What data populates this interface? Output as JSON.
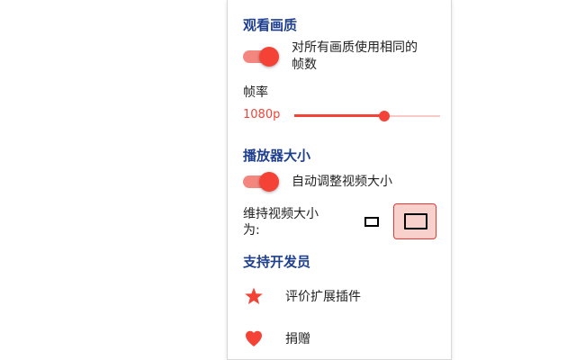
{
  "colors": {
    "accent": "#f44336",
    "section_title": "#1f3f8f",
    "toggle_track": "#f3877f",
    "size_selected_bg": "#f8d0cc"
  },
  "quality": {
    "title": "观看画质",
    "same_fps_toggle": {
      "checked": true,
      "label_line1": "对所有画质使用相同的",
      "label_line2": "帧数"
    },
    "fps_label": "帧率",
    "slider": {
      "value_label": "1080p",
      "position_fraction": 0.615
    }
  },
  "player_size": {
    "title": "播放器大小",
    "auto_resize_toggle": {
      "checked": true,
      "label": "自动调整视频大小"
    },
    "keep_size_label_line1": "维持视频大小",
    "keep_size_label_line2": "为:",
    "size_options": [
      {
        "name": "small",
        "icon": "small-rectangle-icon",
        "selected": false
      },
      {
        "name": "large",
        "icon": "large-rectangle-icon",
        "selected": true
      }
    ]
  },
  "support": {
    "title": "支持开发员",
    "items": [
      {
        "icon": "star-icon",
        "label": "评价扩展插件"
      },
      {
        "icon": "heart-icon",
        "label": "捐赠"
      }
    ]
  }
}
